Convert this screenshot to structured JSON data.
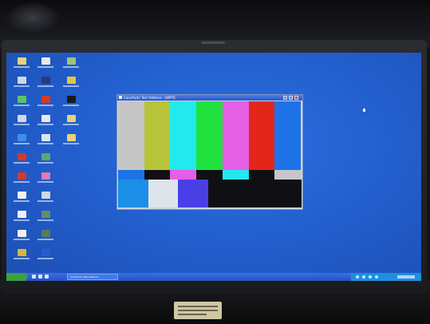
{
  "window": {
    "title": "ColorFacts Test Patterns - SMPTE"
  },
  "taskbar": {
    "task_label": "ColorFacts Test Patterns"
  },
  "colors": {
    "desktop": "#2360d0",
    "bars_top": [
      "#c6c6c6",
      "#b7c43a",
      "#22e9ee",
      "#20e23f",
      "#e55ee6",
      "#e22619",
      "#1c73e8"
    ],
    "bars_castellation": [
      "#1c73e8",
      "#101014",
      "#e55ee6",
      "#101014",
      "#22e9ee",
      "#101014",
      "#c6c6c6"
    ],
    "bars_pluge": [
      "#1d8fe6",
      "#dfe4ea",
      "#4a3fe6",
      "#101014"
    ]
  }
}
